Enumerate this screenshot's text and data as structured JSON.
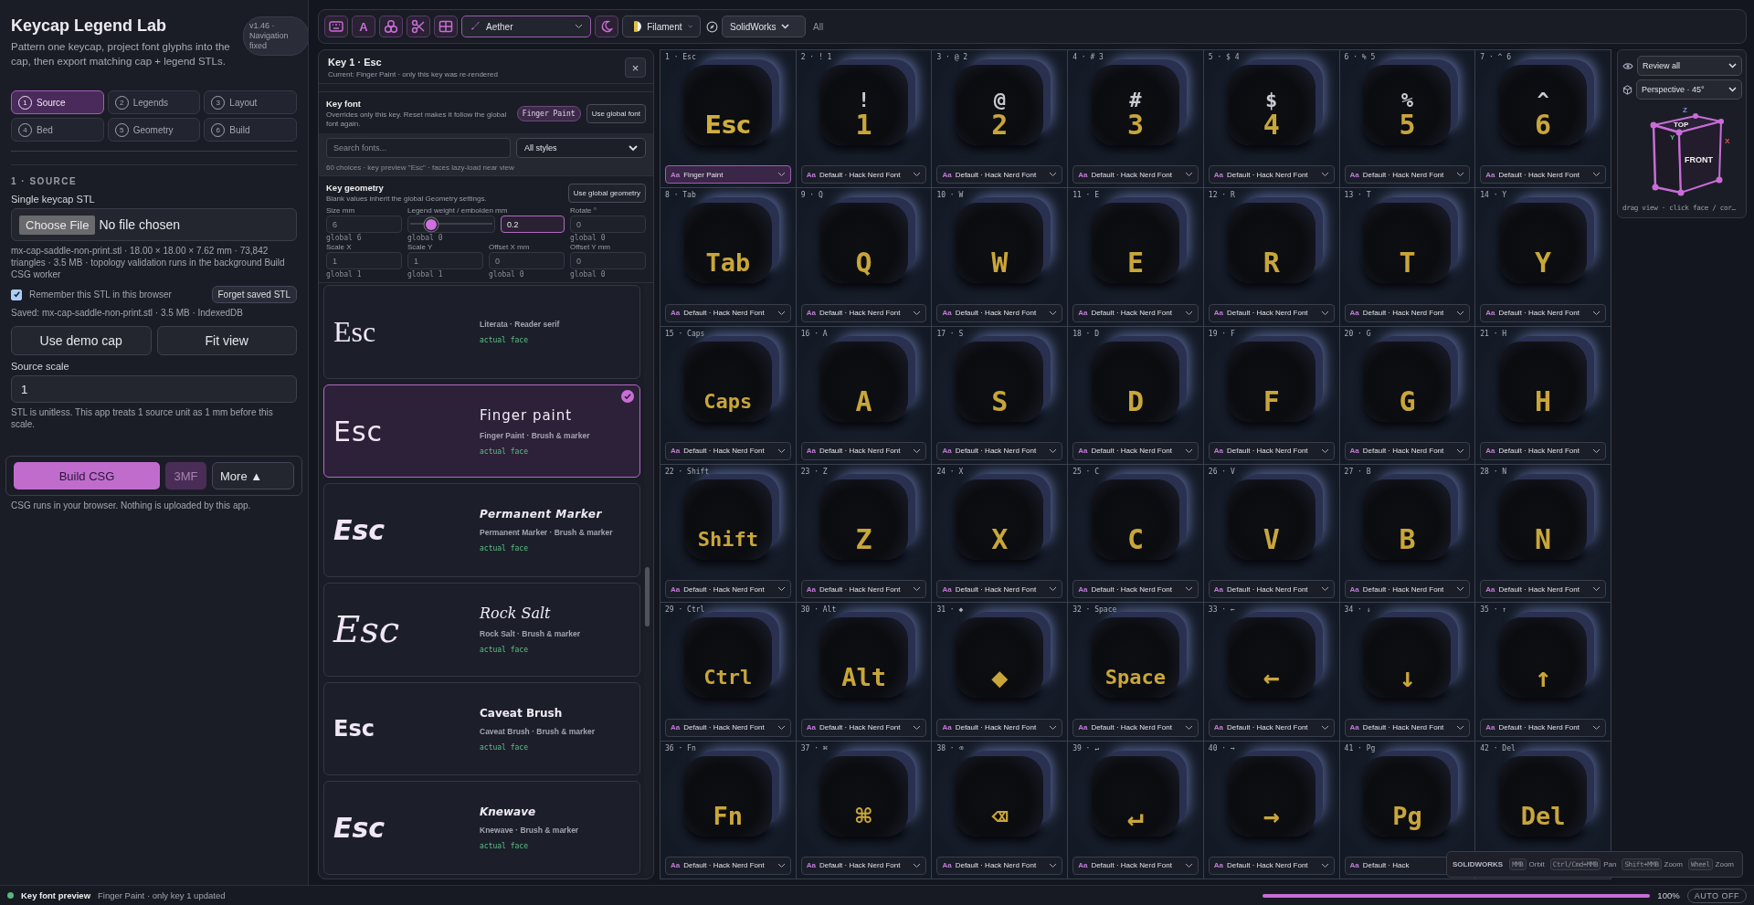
{
  "sidebar": {
    "title": "Keycap Legend Lab",
    "version": "v1.46 · Navigation fixed",
    "description": "Pattern one keycap, project font glyphs into the cap, then export matching cap + legend STLs.",
    "steps": [
      {
        "num": "1",
        "label": "Source",
        "selected": true
      },
      {
        "num": "2",
        "label": "Legends",
        "selected": false
      },
      {
        "num": "3",
        "label": "Layout",
        "selected": false
      },
      {
        "num": "4",
        "label": "Bed",
        "selected": false
      },
      {
        "num": "5",
        "label": "Geometry",
        "selected": false
      },
      {
        "num": "6",
        "label": "Build",
        "selected": false
      }
    ],
    "section_title": "1 · SOURCE",
    "stl_label": "Single keycap STL",
    "file_button": "Choose File",
    "file_status": "No file chosen",
    "file_info": "mx-cap-saddle-non-print.stl · 18.00 × 18.00 × 7.62 mm · 73,842 triangles · 3.5 MB · topology validation runs in the background Build CSG worker",
    "remember": {
      "label": "Remember this STL in this browser",
      "checked": true
    },
    "forget_button": "Forget saved STL",
    "saved_info": "Saved: mx-cap-saddle-non-print.stl · 3.5 MB · IndexedDB",
    "demo_button": "Use demo cap",
    "fit_button": "Fit view",
    "scale_label": "Source scale",
    "scale_value": "1",
    "scale_help": "STL is unitless. This app treats 1 source unit as 1 mm before this scale.",
    "build_button": "Build CSG",
    "export_button": "3MF",
    "export_disabled": true,
    "more_button": "More ▲",
    "build_note": "CSG runs in your browser. Nothing is uploaded by this app."
  },
  "toolbar": {
    "tools": [
      {
        "kind": "keyboard"
      },
      {
        "kind": "letter",
        "glyph": "A"
      },
      {
        "kind": "shapes"
      },
      {
        "kind": "scissors"
      },
      {
        "kind": "layout"
      }
    ],
    "theme": "Aether",
    "filament": "Filament",
    "camera_preset": "SolidWorks",
    "filter": "All"
  },
  "editor": {
    "title": "Key 1 · Esc",
    "subtitle": "Current: Finger Paint · only this key was re-rendered",
    "close": "×",
    "font_title": "Key font",
    "font_desc": "Overrides only this key. Reset makes it follow the global font again.",
    "font_pill": "Finger Paint",
    "global_font_button": "Use global font",
    "search_placeholder": "Search fonts...",
    "style_filter": "All styles",
    "choices_note": "60 choices · key preview \"Esc\" · faces lazy-load near view",
    "geometry_title": "Key geometry",
    "geometry_desc": "Blank values inherit the global Geometry settings.",
    "global_geometry_button": "Use global geometry",
    "fields": [
      {
        "kind": "input",
        "label": "Size mm",
        "placeholder": "6",
        "hint": "global 6"
      },
      {
        "kind": "slider",
        "label": "Legend weight / embolden mm",
        "level": 0.27,
        "value": "0.2",
        "hint": "global 0"
      },
      {
        "kind": "input",
        "label": "Rotate °",
        "placeholder": "0",
        "hint": "global 0"
      },
      {
        "kind": "input",
        "label": "Scale X",
        "placeholder": "1",
        "hint": "global 1"
      },
      {
        "kind": "input",
        "label": "Scale Y",
        "placeholder": "1",
        "hint": "global 1"
      },
      {
        "kind": "input",
        "label": "Offset X mm",
        "placeholder": "0",
        "hint": "global 0"
      },
      {
        "kind": "input",
        "label": "Offset Y mm",
        "placeholder": "0",
        "hint": "global 0"
      }
    ],
    "fonts": [
      {
        "kind": "serif",
        "preview": "Esc",
        "meta": "Literata · Reader serif",
        "tag": "actual face",
        "selected": false
      },
      {
        "kind": "paint",
        "preview": "Esc",
        "name": "Finger paint",
        "meta": "Finger Paint · Brush & marker",
        "tag": "actual face",
        "selected": true
      },
      {
        "kind": "marker",
        "preview": "Esc",
        "name": "Permanent Marker",
        "meta": "Permanent Marker · Brush & marker",
        "tag": "actual face",
        "selected": false
      },
      {
        "kind": "rough",
        "preview": "Esc",
        "name": "Rock Salt",
        "meta": "Rock Salt · Brush & marker",
        "tag": "actual face",
        "selected": false
      },
      {
        "kind": "brush",
        "preview": "Esc",
        "name": "Caveat Brush",
        "meta": "Caveat Brush · Brush & marker",
        "tag": "actual face",
        "selected": false
      },
      {
        "kind": "heavy",
        "preview": "Esc",
        "name": "Knewave",
        "meta": "Knewave · Brush & marker",
        "tag": "actual face",
        "selected": false
      }
    ]
  },
  "keys": [
    {
      "label": "1 · Esc",
      "legend": "Esc",
      "icon": "Aa",
      "font": "Finger Paint",
      "selected": true
    },
    {
      "label": "2 · ! 1",
      "shift_legend": "!",
      "legend": "1",
      "icon": "Aa",
      "font": "Default · Hack Nerd Font",
      "selected": false
    },
    {
      "label": "3 · @ 2",
      "shift_legend": "@",
      "legend": "2",
      "icon": "Aa",
      "font": "Default · Hack Nerd Font",
      "selected": false
    },
    {
      "label": "4 · # 3",
      "shift_legend": "#",
      "legend": "3",
      "icon": "Aa",
      "font": "Default · Hack Nerd Font",
      "selected": false
    },
    {
      "label": "5 · $ 4",
      "shift_legend": "$",
      "legend": "4",
      "icon": "Aa",
      "font": "Default · Hack Nerd Font",
      "selected": false
    },
    {
      "label": "6 · % 5",
      "shift_legend": "%",
      "legend": "5",
      "icon": "Aa",
      "font": "Default · Hack Nerd Font",
      "selected": false
    },
    {
      "label": "7 · ^ 6",
      "shift_legend": "^",
      "legend": "6",
      "icon": "Aa",
      "font": "Default · Hack Nerd Font",
      "selected": false
    },
    {
      "label": "8 · Tab",
      "legend": "Tab",
      "icon": "Aa",
      "font": "Default · Hack Nerd Font",
      "selected": false
    },
    {
      "label": "9 · Q",
      "legend": "Q",
      "icon": "Aa",
      "font": "Default · Hack Nerd Font",
      "selected": false
    },
    {
      "label": "10 · W",
      "legend": "W",
      "icon": "Aa",
      "font": "Default · Hack Nerd Font",
      "selected": false
    },
    {
      "label": "11 · E",
      "legend": "E",
      "icon": "Aa",
      "font": "Default · Hack Nerd Font",
      "selected": false
    },
    {
      "label": "12 · R",
      "legend": "R",
      "icon": "Aa",
      "font": "Default · Hack Nerd Font",
      "selected": false
    },
    {
      "label": "13 · T",
      "legend": "T",
      "icon": "Aa",
      "font": "Default · Hack Nerd Font",
      "selected": false
    },
    {
      "label": "14 · Y",
      "legend": "Y",
      "icon": "Aa",
      "font": "Default · Hack Nerd Font",
      "selected": false
    },
    {
      "label": "15 · Caps",
      "legend": "Caps",
      "icon": "Aa",
      "font": "Default · Hack Nerd Font",
      "selected": false
    },
    {
      "label": "16 · A",
      "legend": "A",
      "icon": "Aa",
      "font": "Default · Hack Nerd Font",
      "selected": false
    },
    {
      "label": "17 · S",
      "legend": "S",
      "icon": "Aa",
      "font": "Default · Hack Nerd Font",
      "selected": false
    },
    {
      "label": "18 · D",
      "legend": "D",
      "icon": "Aa",
      "font": "Default · Hack Nerd Font",
      "selected": false
    },
    {
      "label": "19 · F",
      "legend": "F",
      "icon": "Aa",
      "font": "Default · Hack Nerd Font",
      "selected": false
    },
    {
      "label": "20 · G",
      "legend": "G",
      "icon": "Aa",
      "font": "Default · Hack Nerd Font",
      "selected": false
    },
    {
      "label": "21 · H",
      "legend": "H",
      "icon": "Aa",
      "font": "Default · Hack Nerd Font",
      "selected": false
    },
    {
      "label": "22 · Shift",
      "legend": "Shift",
      "icon": "Aa",
      "font": "Default · Hack Nerd Font",
      "selected": false
    },
    {
      "label": "23 · Z",
      "legend": "Z",
      "icon": "Aa",
      "font": "Default · Hack Nerd Font",
      "selected": false
    },
    {
      "label": "24 · X",
      "legend": "X",
      "icon": "Aa",
      "font": "Default · Hack Nerd Font",
      "selected": false
    },
    {
      "label": "25 · C",
      "legend": "C",
      "icon": "Aa",
      "font": "Default · Hack Nerd Font",
      "selected": false
    },
    {
      "label": "26 · V",
      "legend": "V",
      "icon": "Aa",
      "font": "Default · Hack Nerd Font",
      "selected": false
    },
    {
      "label": "27 · B",
      "legend": "B",
      "icon": "Aa",
      "font": "Default · Hack Nerd Font",
      "selected": false
    },
    {
      "label": "28 · N",
      "legend": "N",
      "icon": "Aa",
      "font": "Default · Hack Nerd Font",
      "selected": false
    },
    {
      "label": "29 · Ctrl",
      "legend": "Ctrl",
      "icon": "Aa",
      "font": "Default · Hack Nerd Font",
      "selected": false
    },
    {
      "label": "30 · Alt",
      "legend": "Alt",
      "icon": "Aa",
      "font": "Default · Hack Nerd Font",
      "selected": false
    },
    {
      "label": "31 · ◆",
      "legend": "◆",
      "icon": "Aa",
      "font": "Default · Hack Nerd Font",
      "selected": false
    },
    {
      "label": "32 · Space",
      "legend": "Space",
      "icon": "Aa",
      "font": "Default · Hack Nerd Font",
      "selected": false
    },
    {
      "label": "33 · ←",
      "legend": "←",
      "icon": "Aa",
      "font": "Default · Hack Nerd Font",
      "selected": false
    },
    {
      "label": "34 · ↓",
      "legend": "↓",
      "icon": "Aa",
      "font": "Default · Hack Nerd Font",
      "selected": false
    },
    {
      "label": "35 · ↑",
      "legend": "↑",
      "icon": "Aa",
      "font": "Default · Hack Nerd Font",
      "selected": false
    },
    {
      "label": "36 · Fn",
      "legend": "Fn",
      "icon": "Aa",
      "font": "Default · Hack Nerd Font",
      "selected": false
    },
    {
      "label": "37 · ⌘",
      "legend": "⌘",
      "icon": "Aa",
      "font": "Default · Hack Nerd Font",
      "selected": false
    },
    {
      "label": "38 · ⌫",
      "legend": "⌫",
      "icon": "Aa",
      "font": "Default · Hack Nerd Font",
      "selected": false
    },
    {
      "label": "39 · ↵",
      "legend": "↵",
      "icon": "Aa",
      "font": "Default · Hack Nerd Font",
      "selected": false
    },
    {
      "label": "40 · →",
      "legend": "→",
      "icon": "Aa",
      "font": "Default · Hack Nerd Font",
      "selected": false
    },
    {
      "label": "41 · Pg",
      "legend": "Pg",
      "icon": "Aa",
      "font": "Default · Hack",
      "selected": false
    },
    {
      "label": "42 · Del",
      "legend": "Del"
    }
  ],
  "view": {
    "mode": "Review all",
    "projection": "Perspective · 45°",
    "cube_z": "Z",
    "cube_top": "TOP",
    "cube_y": "Y",
    "cube_front": "FRONT",
    "cube_x": "X",
    "caption": "drag view · click face / cor…"
  },
  "hint": {
    "title": "SOLIDWORKS",
    "items": [
      {
        "key": "MMB",
        "action": "Orbit"
      },
      {
        "key": "Ctrl/Cmd+MMB",
        "action": "Pan"
      },
      {
        "key": "Shift+MMB",
        "action": "Zoom"
      },
      {
        "key": "Wheel",
        "action": "Zoom"
      }
    ]
  },
  "status": {
    "title": "Key font preview",
    "message": "Finger Paint · only key 1 updated",
    "level": 1,
    "percent": "100%",
    "auto_button": "AUTO OFF"
  }
}
